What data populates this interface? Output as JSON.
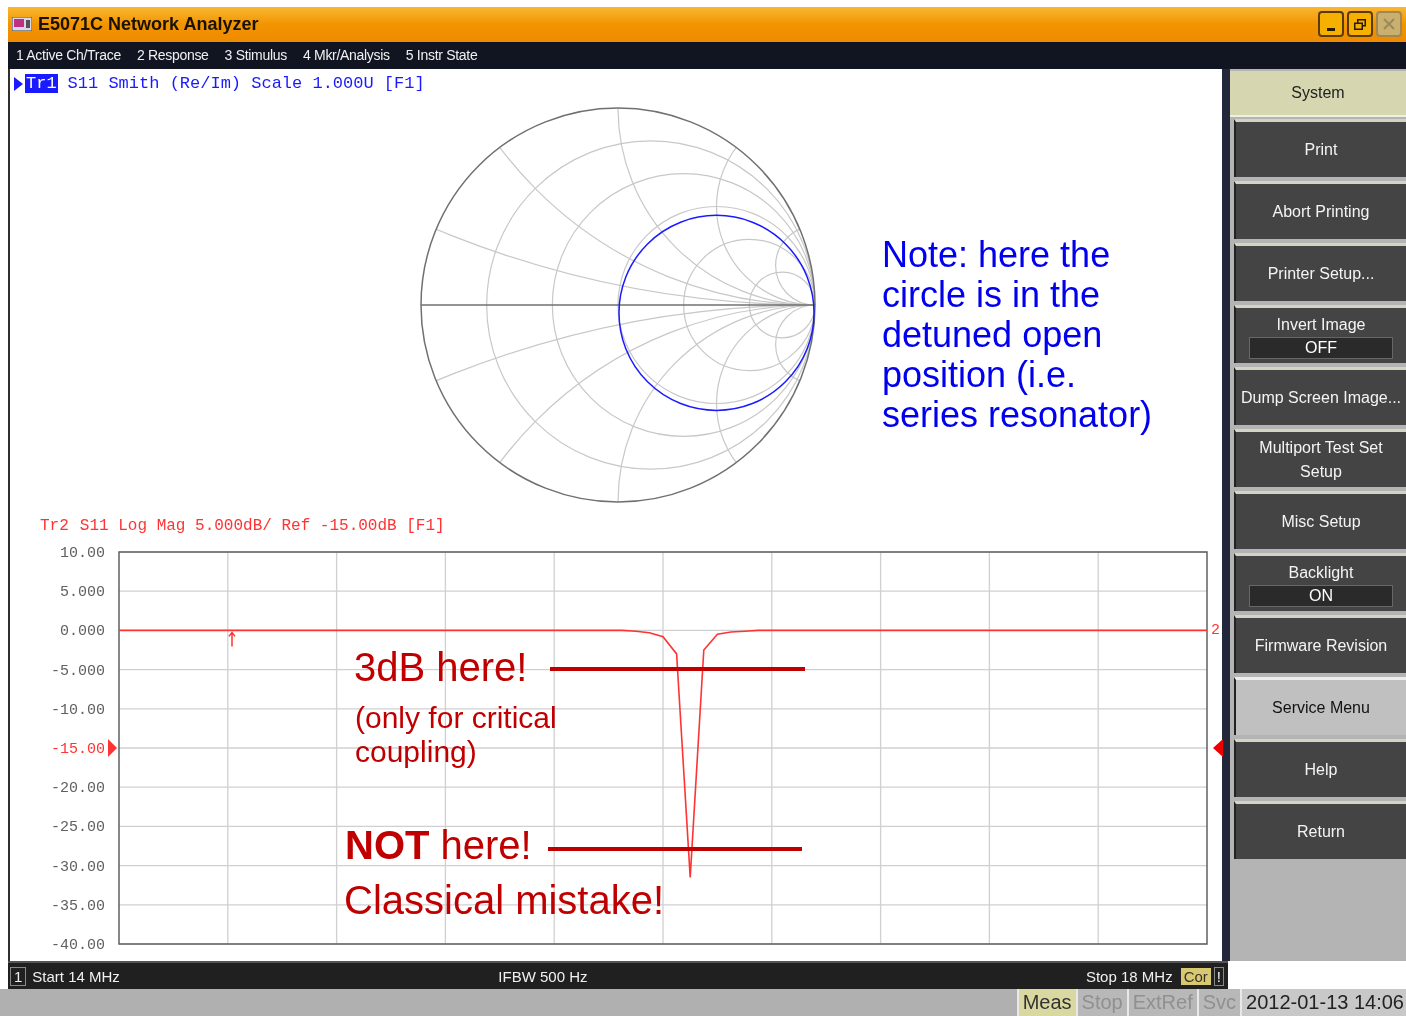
{
  "window": {
    "title": "E5071C Network Analyzer",
    "buttons": [
      {
        "kind": "minimize",
        "disabled": false
      },
      {
        "kind": "restore",
        "disabled": false
      },
      {
        "kind": "close",
        "disabled": true
      }
    ]
  },
  "menu": [
    "1 Active Ch/Trace",
    "2 Response",
    "3 Stimulus",
    "4 Mkr/Analysis",
    "5 Instr State"
  ],
  "smith_panel": {
    "trace": {
      "label": "Tr1",
      "active": true,
      "description": "S11 Smith (Re/Im) Scale 1.000U [F1]",
      "color": "#1a1aff"
    },
    "note": "Note: here the circle is in the detuned open position (i.e. series resonator)"
  },
  "logmag_panel": {
    "trace": {
      "label": "Tr2",
      "active": false,
      "description": "S11 Log Mag 5.000dB/ Ref -15.00dB [F1]",
      "color": "#ff3333",
      "end_label": "2"
    },
    "chart_data": {
      "type": "line",
      "grid": true,
      "categories": [
        null,
        null,
        null,
        null,
        null,
        null,
        null,
        null,
        null,
        null,
        null,
        null,
        null,
        null,
        null,
        null,
        null,
        null,
        null,
        null,
        null,
        null,
        null,
        null,
        null,
        null,
        null,
        null,
        null,
        null,
        null,
        null,
        null,
        null,
        null,
        null,
        null,
        null,
        null,
        null,
        null,
        null,
        null,
        null,
        null,
        null,
        null,
        null,
        null,
        null,
        null,
        null,
        null,
        null,
        null,
        null,
        null,
        null,
        null,
        null,
        null,
        null,
        null,
        null,
        null,
        null,
        null,
        null,
        null,
        null,
        null,
        null,
        null,
        null,
        null,
        null,
        null,
        null,
        null,
        null,
        null
      ],
      "ylim": [
        -40,
        10
      ],
      "yticks": [
        {
          "value": 10,
          "label": "10.00"
        },
        {
          "value": 5,
          "label": "5.000"
        },
        {
          "value": 0,
          "label": "0.000"
        },
        {
          "value": -5,
          "label": "-5.000"
        },
        {
          "value": -10,
          "label": "-10.00"
        },
        {
          "value": -15,
          "label": "-15.00"
        },
        {
          "value": -20,
          "label": "-20.00"
        },
        {
          "value": -25,
          "label": "-25.00"
        },
        {
          "value": -30,
          "label": "-30.00"
        },
        {
          "value": -35,
          "label": "-35.00"
        },
        {
          "value": -40,
          "label": "-40.00"
        }
      ],
      "series": [
        {
          "color": "#ff3333",
          "values": [
            0,
            0,
            0,
            0,
            0,
            0,
            0,
            0,
            0,
            0,
            0,
            0,
            0,
            0,
            0,
            0,
            0,
            0,
            0,
            0,
            0,
            0,
            0,
            0,
            0,
            0,
            0,
            0,
            0,
            0,
            0,
            0,
            0,
            0,
            0,
            0,
            0,
            0,
            -0.1,
            -0.3,
            -0.8,
            -3,
            -31.5,
            -2.5,
            -0.5,
            -0.2,
            -0.1,
            0,
            0,
            0,
            0,
            0,
            0,
            0,
            0,
            0,
            0,
            0,
            0,
            0,
            0,
            0,
            0,
            0,
            0,
            0,
            0,
            0,
            0,
            0,
            0,
            0,
            0,
            0,
            0,
            0,
            0,
            0,
            0,
            0,
            0
          ]
        }
      ]
    },
    "annotations": [
      {
        "kind": "callout",
        "text": "3dB here!"
      },
      {
        "kind": "note",
        "text": "(only for critical coupling)"
      },
      {
        "kind": "callout",
        "text": "**NOT** here!"
      },
      {
        "kind": "note",
        "text": "Classical mistake!"
      }
    ]
  },
  "softkey_menu": {
    "title": "System",
    "keys": [
      {
        "label": "Print",
        "selected": false
      },
      {
        "label": "Abort Printing",
        "selected": false
      },
      {
        "label": "Printer Setup...",
        "selected": false
      },
      {
        "label": "Invert Image",
        "value": "OFF",
        "selected": false
      },
      {
        "label": "Dump Screen Image...",
        "selected": false
      },
      {
        "label": "Multiport Test Set Setup",
        "selected": false
      },
      {
        "label": "Misc Setup",
        "selected": false
      },
      {
        "label": "Backlight",
        "value": "ON",
        "selected": false
      },
      {
        "label": "Firmware Revision",
        "selected": false
      },
      {
        "label": "Service Menu",
        "selected": true
      },
      {
        "label": "Help",
        "selected": false
      },
      {
        "label": "Return",
        "selected": false
      }
    ]
  },
  "status_bar": {
    "channel": "1",
    "start": "Start 14 MHz",
    "ifbw": "IFBW 500 Hz",
    "stop": "Stop 18 MHz",
    "correction": "Cor",
    "warning": "!"
  },
  "instrument_bar": {
    "indicators": [
      {
        "label": "Meas",
        "on": true
      },
      {
        "label": "Stop",
        "on": false
      },
      {
        "label": "ExtRef",
        "on": false
      },
      {
        "label": "Svc",
        "on": false
      }
    ],
    "datetime": "2012-01-13 14:06"
  }
}
